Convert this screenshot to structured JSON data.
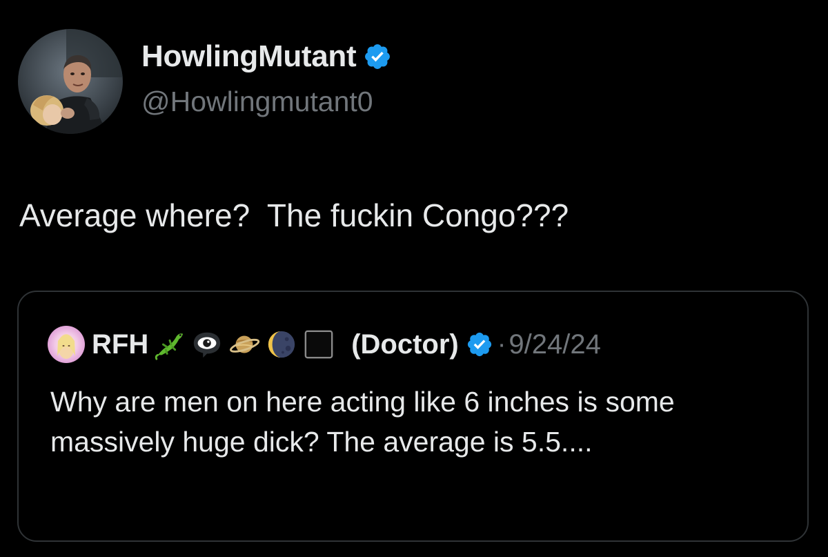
{
  "tweet": {
    "author": {
      "display_name": "HowlingMutant",
      "handle": "@Howlingmutant0",
      "verified": true,
      "avatar_icon": "user-avatar-photo"
    },
    "text": "Average where?  The fuckin Congo???",
    "quoted_tweet": {
      "author": {
        "display_name": "RFH",
        "role": "(Doctor)",
        "verified": true,
        "avatar_icon": "user-avatar-photo",
        "name_emojis": [
          "lizard",
          "eye-in-speech-bubble",
          "ringed-planet",
          "new-moon-face",
          "black-square"
        ]
      },
      "separator": "·",
      "date": "9/24/24",
      "text": "Why are men on here acting like 6 inches is some massively huge dick? The average is 5.5...."
    }
  },
  "colors": {
    "background": "#000000",
    "primary_text": "#e7e9ea",
    "secondary_text": "#71767b",
    "border": "#2f3336",
    "verified_blue": "#1d9bf0"
  }
}
